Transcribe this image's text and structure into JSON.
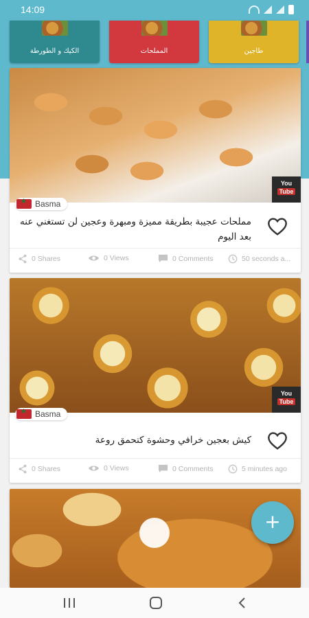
{
  "status_bar": {
    "time": "14:09"
  },
  "categories": [
    {
      "label": "الكيك و الطورطة",
      "color": "#2e8a8f"
    },
    {
      "label": "المملحات",
      "color": "#d2393f"
    },
    {
      "label": "طاجين",
      "color": "#e0b428"
    }
  ],
  "posts": [
    {
      "author": "Basma",
      "title": "مملحات عجيبة بطريقة مميزة ومبهرة وعجين لن تستغني عنه بعد اليوم",
      "shares": "0 Shares",
      "views": "0 Views",
      "comments": "0 Comments",
      "time_ago": "50 seconds a...",
      "badge_top": "You",
      "badge_bottom": "Tube"
    },
    {
      "author": "Basma",
      "title": "كيش بعجين خرافي وحشوة كتحمق روعة",
      "shares": "0 Shares",
      "views": "0 Views",
      "comments": "0 Comments",
      "time_ago": "5 minutes ago",
      "badge_top": "You",
      "badge_bottom": "Tube"
    }
  ],
  "fab": {
    "symbol": "+"
  },
  "colors": {
    "primary": "#5fb9cd",
    "heart": "#333333",
    "stat_gray": "#b3b3b3"
  },
  "icons": [
    "share-icon",
    "eye-icon",
    "comment-icon",
    "clock-icon",
    "heart-icon",
    "youtube-icon",
    "morocco-flag-icon"
  ]
}
